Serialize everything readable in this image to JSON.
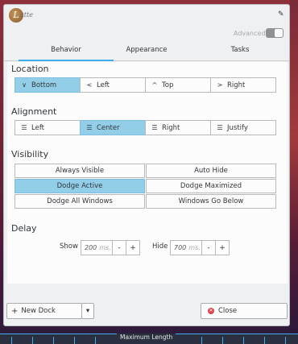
{
  "window": {
    "logo_letter": "L",
    "logo_text": "atte",
    "pin_icon": "pin-icon",
    "advanced_label": "Advanced"
  },
  "tabs": [
    "Behavior",
    "Appearance",
    "Tasks"
  ],
  "location": {
    "title": "Location",
    "options": [
      {
        "label": "Bottom",
        "icon": "chevron-down-icon",
        "glyph": "∨",
        "active": true
      },
      {
        "label": "Left",
        "icon": "chevron-left-icon",
        "glyph": "<",
        "active": false
      },
      {
        "label": "Top",
        "icon": "chevron-up-icon",
        "glyph": "^",
        "active": false
      },
      {
        "label": "Right",
        "icon": "chevron-right-icon",
        "glyph": ">",
        "active": false
      }
    ]
  },
  "alignment": {
    "title": "Alignment",
    "options": [
      {
        "label": "Left",
        "icon": "align-left-icon",
        "glyph": "☰",
        "active": false
      },
      {
        "label": "Center",
        "icon": "align-center-icon",
        "glyph": "☰",
        "active": true
      },
      {
        "label": "Right",
        "icon": "align-right-icon",
        "glyph": "☰",
        "active": false
      },
      {
        "label": "Justify",
        "icon": "align-justify-icon",
        "glyph": "☰",
        "active": false
      }
    ]
  },
  "visibility": {
    "title": "Visibility",
    "options": [
      {
        "label": "Always Visible",
        "active": false
      },
      {
        "label": "Auto Hide",
        "active": false
      },
      {
        "label": "Dodge Active",
        "active": true
      },
      {
        "label": "Dodge Maximized",
        "active": false
      },
      {
        "label": "Dodge All Windows",
        "active": false
      },
      {
        "label": "Windows Go Below",
        "active": false
      }
    ]
  },
  "delay": {
    "title": "Delay",
    "show_label": "Show",
    "show_value": "200",
    "hide_label": "Hide",
    "hide_value": "700",
    "unit": "ms.",
    "minus": "-",
    "plus": "+"
  },
  "footer": {
    "new_dock_label": "New Dock",
    "new_dock_glyph": "+",
    "dropdown_glyph": "▾",
    "close_label": "Close",
    "close_glyph": "✕"
  },
  "taskbar": {
    "label": "Maximum Length"
  },
  "colors": {
    "accent": "#3daee9",
    "active_fill": "#93cee9",
    "close_red": "#da4453"
  }
}
